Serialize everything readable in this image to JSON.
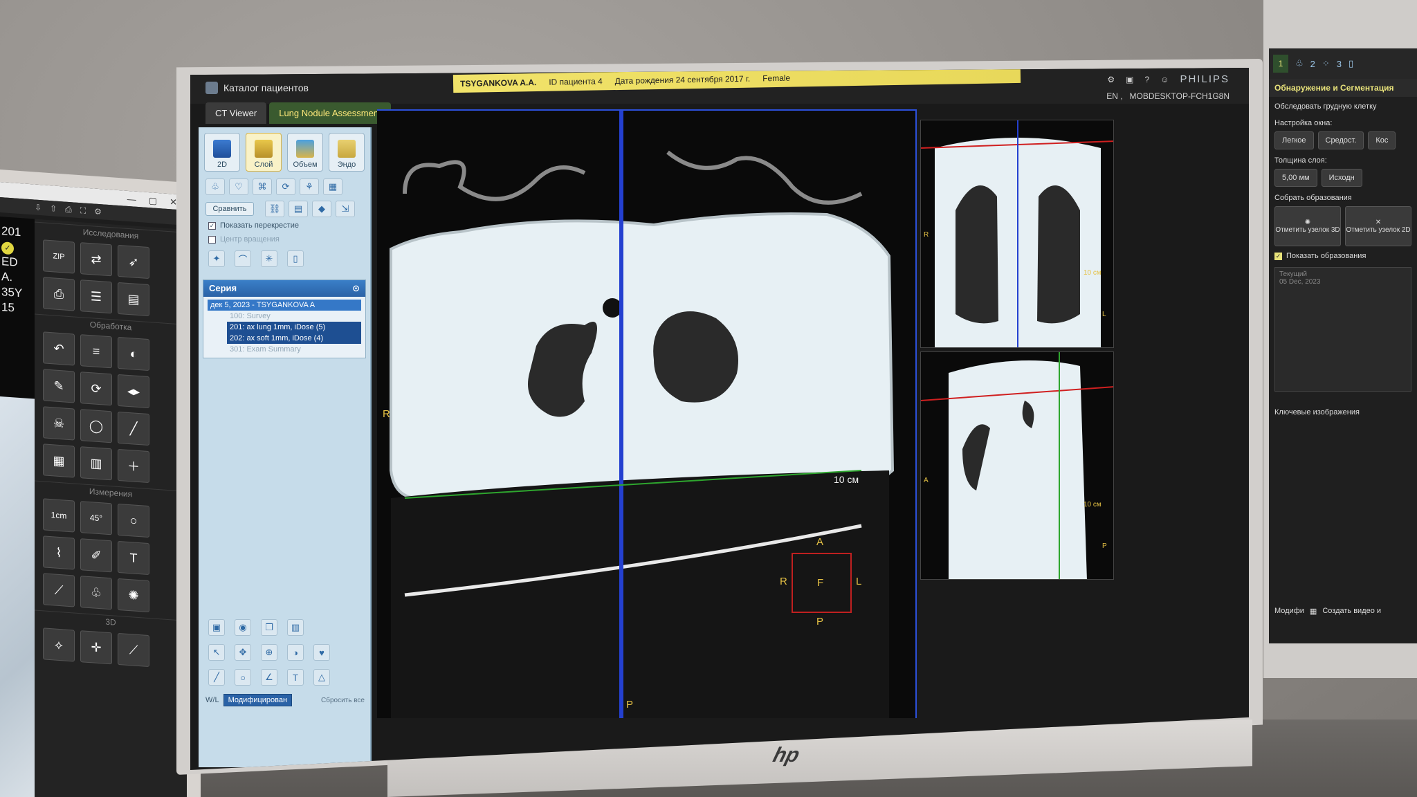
{
  "left_monitor": {
    "window_controls": [
      "—",
      "▢",
      "✕"
    ],
    "side_values": [
      "201",
      "ED",
      "A.",
      "35Y",
      "15"
    ],
    "sections": [
      "Исследования",
      "Обработка",
      "Измерения",
      "3D"
    ],
    "tool_labels": [
      "ZIP",
      "1cm",
      "45°",
      "T"
    ]
  },
  "main": {
    "app_title": "Каталог пациентов",
    "patient": {
      "name": "TSYGANKOVA A.A.",
      "id": "ID пациента 4",
      "dob": "Дата рождения 24 сентября 2017 г.",
      "sex": "Female"
    },
    "brand": "PHILIPS",
    "language": "EN",
    "host": "MOBDESKTOP-FCH1G8N",
    "tabs": [
      "CT Viewer",
      "Lung Nodule Assessment"
    ],
    "active_tab": 1,
    "modes": [
      "2D",
      "Слой",
      "Объем",
      "Эндо"
    ],
    "active_mode": 1,
    "compare_label": "Сравнить",
    "show_crosshair": "Показать перекрестие",
    "rotation_center": "Центр вращения",
    "series": {
      "header": "Серия",
      "study": "дек 5, 2023 - TSYGANKOVA A",
      "items": [
        "100: Survey",
        "201: ax lung 1mm, iDose (5)",
        "202: ax soft 1mm, iDose (4)",
        "301: Exam Summary"
      ]
    },
    "wl_label": "W/L",
    "wl_value": "Модифицирован",
    "reset_label": "Сбросить все",
    "axial": {
      "left_marker": "R",
      "bottom_marker": "P",
      "scale": "10 см",
      "cube": {
        "top": "A",
        "bottom": "P",
        "left": "R",
        "right": "L",
        "center": "F"
      }
    },
    "coronal": {
      "left_marker": "R",
      "scale": "10 см",
      "right_marker": "L"
    },
    "sagittal": {
      "left_marker": "A",
      "scale": "10 см",
      "right_marker": "P"
    }
  },
  "right_monitor": {
    "step_numbers": [
      "1",
      "2",
      "3"
    ],
    "title": "Обнаружение и Сегментация",
    "chest_label": "Обследовать грудную клетку",
    "window_label": "Настройка окна:",
    "window_buttons": [
      "Легкое",
      "Средост.",
      "Кос"
    ],
    "thickness_label": "Толщина слоя:",
    "thickness_value": "5,00 мм",
    "thickness_mode": "Исходн",
    "collect_label": "Собрать образования",
    "mark_3d": "Отметить узелок 3D",
    "mark_2d": "Отметить узелок 2D",
    "show_lesions": "Показать образования",
    "current_label": "Текущий",
    "current_date": "05 Dec, 2023",
    "key_images": "Ключевые изображения",
    "modify": "Модифи",
    "create_video": "Создать видео и"
  }
}
